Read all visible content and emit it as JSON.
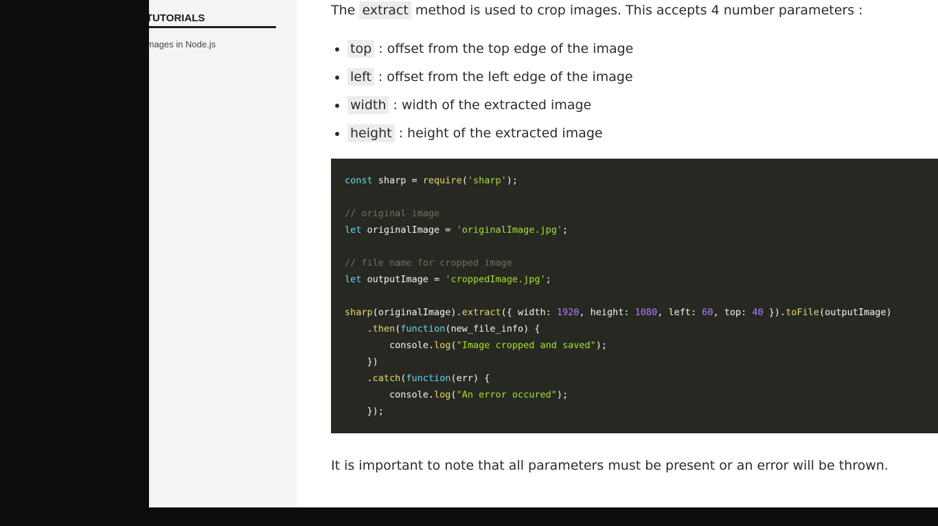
{
  "sidebar": {
    "heading": "ATED TUTORIALS",
    "link": "ng Images in Node.js"
  },
  "intro": {
    "before": "The",
    "code": "extract",
    "after": "method is used to crop images. This accepts 4 number parameters :"
  },
  "params": [
    {
      "code": "top",
      "desc": ": offset from the top edge of the image"
    },
    {
      "code": "left",
      "desc": ": offset from the left edge of the image"
    },
    {
      "code": "width",
      "desc": ": width of the extracted image"
    },
    {
      "code": "height",
      "desc": ": height of the extracted image"
    }
  ],
  "code": {
    "l1": {
      "kw": "const",
      "a": " sharp = ",
      "fn": "require",
      "b": "(",
      "str": "'sharp'",
      "c": ");"
    },
    "l3": {
      "cm": "// original image"
    },
    "l4": {
      "kw": "let",
      "a": " originalImage = ",
      "str": "'originalImage.jpg'",
      "b": ";"
    },
    "l6": {
      "cm": "// file name for cropped image"
    },
    "l7": {
      "kw": "let",
      "a": " outputImage = ",
      "str": "'croppedImage.jpg'",
      "b": ";"
    },
    "l9": {
      "fn1": "sharp",
      "a": "(originalImage).",
      "fn2": "extract",
      "b": "({ width: ",
      "n1": "1920",
      "c": ", height: ",
      "n2": "1080",
      "d": ", left: ",
      "n3": "60",
      "e": ", top: ",
      "n4": "40",
      "f": " }).",
      "fn3": "toFile",
      "g": "(outputImage)"
    },
    "l10": {
      "a": "    .",
      "fn": "then",
      "b": "(",
      "kw": "function",
      "c": "(new_file_info) {"
    },
    "l11": {
      "a": "        console.",
      "fn": "log",
      "b": "(",
      "str": "\"Image cropped and saved\"",
      "c": ");"
    },
    "l12": {
      "a": "    })"
    },
    "l13": {
      "a": "    .",
      "fn": "catch",
      "b": "(",
      "kw": "function",
      "c": "(err) {"
    },
    "l14": {
      "a": "        console.",
      "fn": "log",
      "b": "(",
      "str": "\"An error occured\"",
      "c": ");"
    },
    "l15": {
      "a": "    });"
    }
  },
  "outro": "It is important to note that all parameters must be present or an error will be thrown."
}
